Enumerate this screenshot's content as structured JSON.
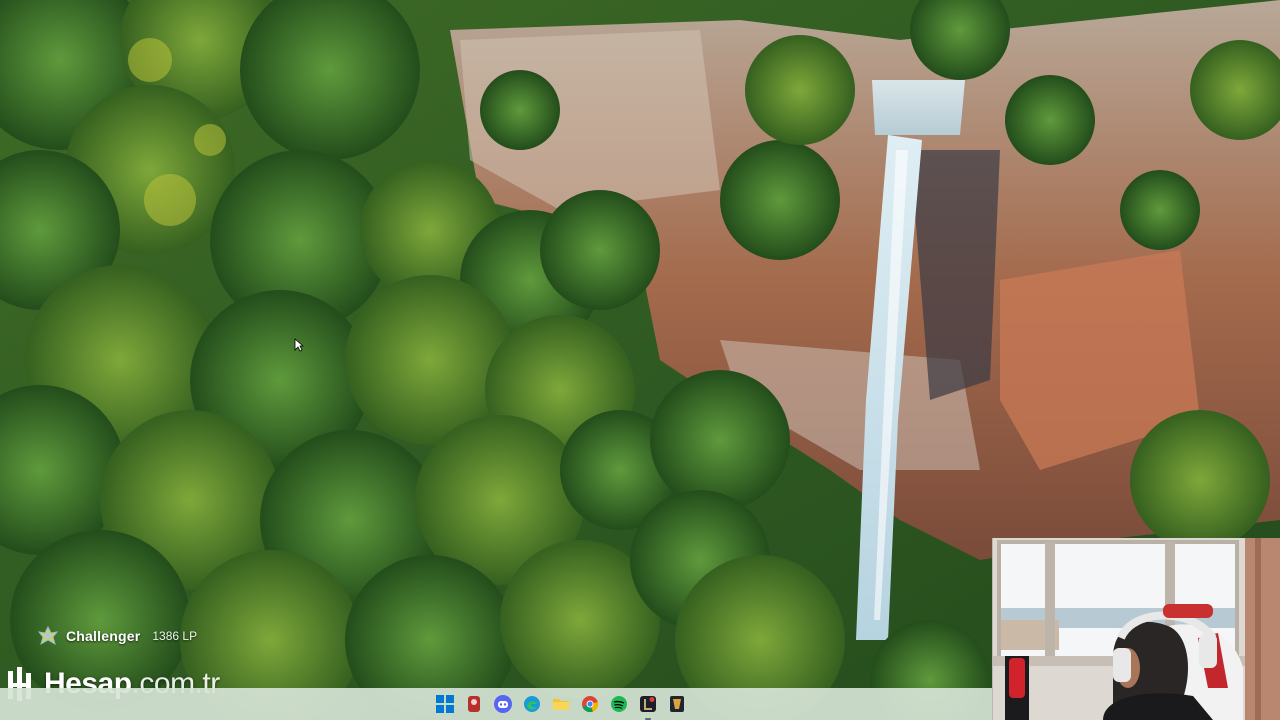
{
  "overlay": {
    "rank_name": "Challenger",
    "rank_lp": "1386 LP",
    "rank_icon": "challenger-rank-icon"
  },
  "watermark": {
    "brand": "Hesap",
    "domain": ".com.tr"
  },
  "taskbar": {
    "icons": [
      "windows-start-icon",
      "app-red-icon",
      "discord-icon",
      "edge-icon",
      "file-explorer-icon",
      "chrome-icon",
      "spotify-icon",
      "league-client-icon",
      "game-launcher-icon"
    ]
  },
  "colors": {
    "taskbar_bg": "#d6e4d6",
    "accent": "#0078d4"
  }
}
